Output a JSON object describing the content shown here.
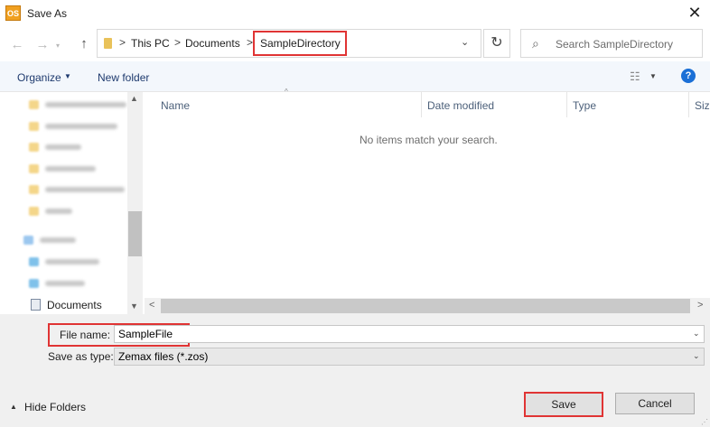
{
  "window": {
    "title": "Save As",
    "app_icon_text": "OS",
    "close_glyph": "✕"
  },
  "nav": {
    "back_icon": "back-arrow-icon",
    "forward_icon": "forward-arrow-icon",
    "up_icon": "up-arrow-icon"
  },
  "address": {
    "crumbs": [
      "This PC",
      "Documents",
      "SampleDirectory"
    ],
    "separator": ">",
    "active_crumb": "SampleDirectory"
  },
  "search": {
    "placeholder": "Search SampleDirectory"
  },
  "toolbar": {
    "organize_label": "Organize",
    "new_folder_label": "New folder"
  },
  "navpane": {
    "visible_item_label": "Documents"
  },
  "content": {
    "columns": [
      "Name",
      "Date modified",
      "Type",
      "Siz"
    ],
    "empty_message": "No items match your search."
  },
  "form": {
    "file_name_label": "File name:",
    "file_name_value": "SampleFile",
    "save_type_label": "Save as type:",
    "save_type_value": "Zemax files (*.zos)"
  },
  "footer": {
    "hide_folders_label": "Hide Folders",
    "save_label": "Save",
    "cancel_label": "Cancel"
  },
  "colors": {
    "highlight": "#e03434",
    "accent": "#1a6fd6",
    "toolbar_bg": "#f3f7fc",
    "panel_bg": "#f0f0f0"
  }
}
